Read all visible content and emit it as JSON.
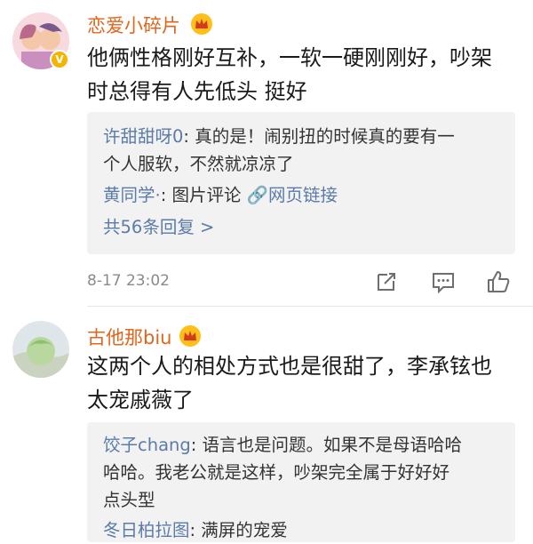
{
  "comments": [
    {
      "username": "恋爱小碎片",
      "text_lines": [
        "他俩性格刚好互补，一软一硬刚刚好，吵架",
        "时总得有人先低头 挺好"
      ],
      "replies": {
        "r1_name": "许甜甜呀0",
        "r1_line1": ": 真的是！闹别扭的时候真的要有一",
        "r1_line2": "个人服软，不然就凉凉了",
        "r2_name": "黄同学·",
        "r2_text": ": 图片评论 ",
        "r2_link": "网页链接",
        "more": "共56条回复 >"
      },
      "timestamp": "8-17 23:02"
    },
    {
      "username": "古他那biu",
      "text_lines": [
        "这两个人的相处方式也是很甜了，李承铉也",
        "太宠戚薇了"
      ],
      "replies": {
        "r1_name": "饺子chang",
        "r1_line1": ": 语言也是问题。如果不是母语哈哈",
        "r1_line2": "哈哈。我老公就是这样，吵架完全属于好好好",
        "r1_line3": "点头型",
        "r2_name": "冬日柏拉图",
        "r2_text": ": 满屏的宠爱"
      }
    }
  ],
  "colors": {
    "username": "#e0661c",
    "reply_name": "#5b7ba8",
    "reply_bg": "#f2f2f2",
    "meta": "#8a8a8a"
  },
  "icons": [
    "vip-crown-icon",
    "verified-badge-icon",
    "share-icon",
    "comment-icon",
    "like-icon"
  ]
}
